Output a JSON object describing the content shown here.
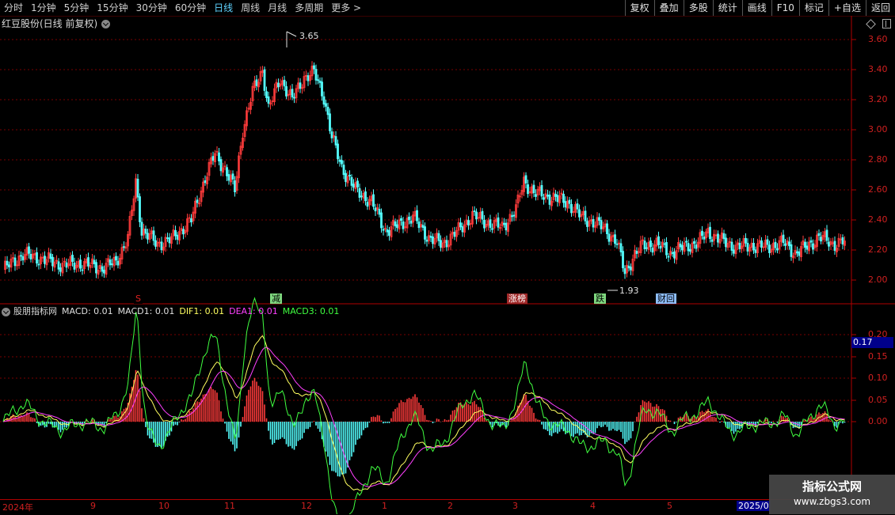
{
  "toolbar": {
    "periods": [
      "分时",
      "1分钟",
      "5分钟",
      "15分钟",
      "30分钟",
      "60分钟",
      "日线",
      "周线",
      "月线",
      "多周期",
      "更多 >"
    ],
    "active_period": "日线",
    "buttons": [
      "复权",
      "叠加",
      "多股",
      "统计",
      "画线",
      "F10",
      "标记",
      "+自选",
      "返回"
    ]
  },
  "chart": {
    "title": "红豆股份(日线 前复权)",
    "price_labels": [
      "3.60",
      "3.40",
      "3.20",
      "3.00",
      "2.80",
      "2.60",
      "2.40",
      "2.20",
      "2.00"
    ],
    "high_label": "3.65",
    "low_label": "1.93"
  },
  "markers": [
    {
      "text": "S",
      "color": "#e02020",
      "bg": "#000000"
    },
    {
      "text": "减",
      "color": "#000000",
      "bg": "#7fd87f"
    },
    {
      "text": "涨榜",
      "color": "#ffffff",
      "bg": "#a02828"
    },
    {
      "text": "跌",
      "color": "#000000",
      "bg": "#7fd87f"
    },
    {
      "text": "财回",
      "color": "#000000",
      "bg": "#8fc0ff"
    }
  ],
  "indicator": {
    "name": "股朋指标网",
    "macd": "MACD: 0.01",
    "macd1": "MACD1: 0.01",
    "dif1": "DIF1: 0.01",
    "dea1": "DEA1: 0.01",
    "macd3": "MACD3: 0.01",
    "axis_labels": [
      "0.20",
      "0.15",
      "0.10",
      "0.05",
      "0.00"
    ],
    "cursor_value": "0.17"
  },
  "dates": [
    "2024年",
    "9",
    "10",
    "11",
    "12",
    "1",
    "2",
    "3",
    "4",
    "5",
    "2025/0"
  ],
  "watermark": {
    "title": "指标公式网",
    "url": "www.zbgs3.com"
  },
  "colors": {
    "up": "#ff3b3b",
    "down": "#54ffff",
    "dif": "#ffff60",
    "dea": "#ff40ff",
    "macd3": "#40ff40",
    "grid": "#7a0000"
  }
}
